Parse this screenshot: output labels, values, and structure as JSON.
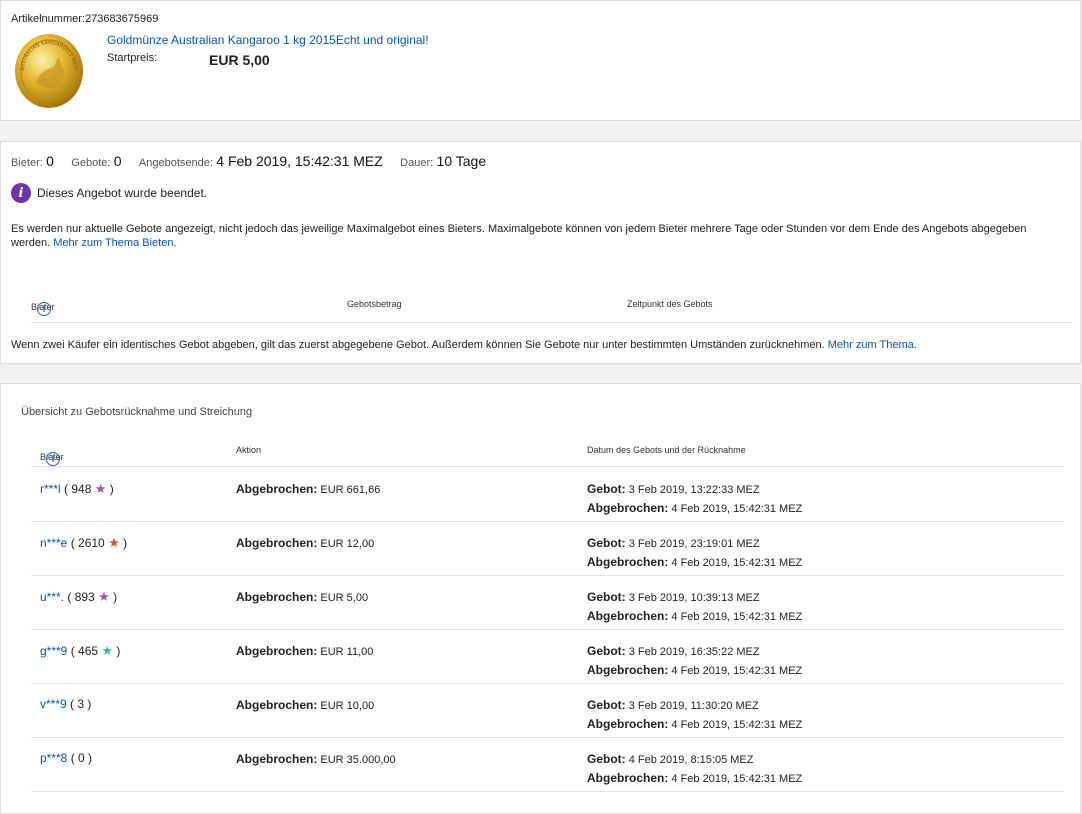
{
  "item": {
    "artnr_label": "Artikelnummer:",
    "artnr": "273683675969",
    "title": "Goldmünze Australian Kangaroo 1 kg 2015Echt und original!",
    "start_label": "Startpreis:",
    "start_value": "EUR 5,00",
    "coin_text": "AUSTRALIAN KANGAROO 1 KILO 2015"
  },
  "stats": {
    "bieter_label": "Bieter:",
    "bieter": "0",
    "gebote_label": "Gebote:",
    "gebote": "0",
    "ende_label": "Angebotsende:",
    "ende": "4 Feb 2019, 15:42:31 MEZ",
    "dauer_label": "Dauer:",
    "dauer": "10 Tage"
  },
  "ended_text": "Dieses Angebot wurde beendet.",
  "notice": {
    "text": "Es werden nur aktuelle Gebote angezeigt, nicht jedoch das jeweilige Maximalgebot eines Bieters. Maximalgebote können von jedem Bieter mehrere Tage oder Stunden vor dem Ende des Angebots abgegeben werden.",
    "link": "Mehr zum Thema Bieten."
  },
  "bids_table": {
    "col_bieter": "Bieter",
    "col_betrag": "Gebotsbetrag",
    "col_zeit": "Zeitpunkt des Gebots"
  },
  "footnote": {
    "text": "Wenn zwei Käufer ein identisches Gebot abgeben, gilt das zuerst abgegebene Gebot. Außerdem können Sie Gebote nur unter bestimmten Umständen zurücknehmen.",
    "link": "Mehr zum Thema."
  },
  "retract": {
    "title": "Übersicht zu Gebotsrücknahme und Streichung",
    "col_bieter": "Bieter",
    "col_aktion": "Aktion",
    "col_datum": "Datum des Gebots und der Rücknahme",
    "action_label": "Abgebrochen:",
    "bid_label": "Gebot:",
    "retract_label": "Abgebrochen:",
    "rows": [
      {
        "bidder": "r***l",
        "score": "948",
        "star_color": "#a24fc2",
        "amount": "EUR 661,66",
        "bid_date": "3 Feb 2019, 13:22:33 MEZ",
        "retract_date": "4 Feb 2019, 15:42:31 MEZ"
      },
      {
        "bidder": "n***e",
        "score": "2610",
        "star_color": "#e0541f",
        "amount": "EUR 12,00",
        "bid_date": "3 Feb 2019, 23:19:01 MEZ",
        "retract_date": "4 Feb 2019, 15:42:31 MEZ"
      },
      {
        "bidder": "u***.",
        "score": "893",
        "star_color": "#a24fc2",
        "amount": "EUR 5,00",
        "bid_date": "3 Feb 2019, 10:39:13 MEZ",
        "retract_date": "4 Feb 2019, 15:42:31 MEZ"
      },
      {
        "bidder": "g***9",
        "score": "465",
        "star_color": "#2bc0a8",
        "amount": "EUR 11,00",
        "bid_date": "3 Feb 2019, 16:35:22 MEZ",
        "retract_date": "4 Feb 2019, 15:42:31 MEZ"
      },
      {
        "bidder": "v***9",
        "score": "3",
        "star_color": "",
        "amount": "EUR 10,00",
        "bid_date": "3 Feb 2019, 11:30:20 MEZ",
        "retract_date": "4 Feb 2019, 15:42:31 MEZ"
      },
      {
        "bidder": "p***8",
        "score": "0",
        "star_color": "",
        "amount": "EUR 35.000,00",
        "bid_date": "4 Feb 2019, 8:15:05 MEZ",
        "retract_date": "4 Feb 2019, 15:42:31 MEZ"
      }
    ]
  },
  "icons": {
    "info_badge": "info-badge-icon",
    "info_circle": "info-circle-icon",
    "star": "feedback-star-icon"
  }
}
